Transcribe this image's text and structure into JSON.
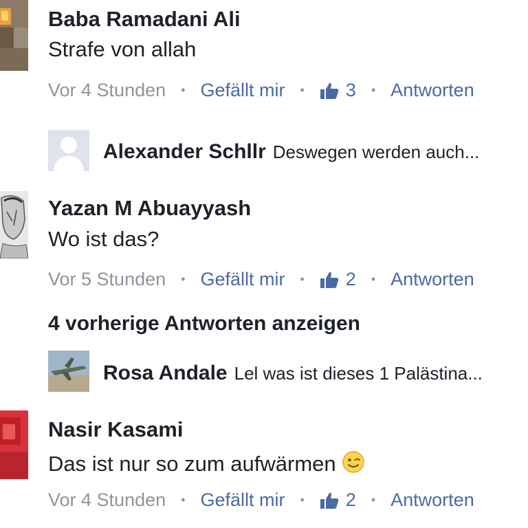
{
  "comments": [
    {
      "author": "Baba Ramadani Ali",
      "text": "Strafe von allah",
      "time": "Vor 4 Stunden",
      "like_label": "Gefällt mir",
      "like_count": "3",
      "reply_label": "Antworten",
      "reply": {
        "author": "Alexander Schllr",
        "snippet": "Deswegen werden auch..."
      }
    },
    {
      "author": "Yazan M Abuayyash",
      "text": "Wo ist das?",
      "time": "Vor 5 Stunden",
      "like_label": "Gefällt mir",
      "like_count": "2",
      "reply_label": "Antworten",
      "more_replies": "4 vorherige Antworten anzeigen",
      "reply": {
        "author": "Rosa Andale",
        "snippet": "Lel was ist dieses 1 Palästina..."
      }
    },
    {
      "author": "Nasir Kasami",
      "text": "Das ist nur so zum aufwärmen",
      "time": "Vor 4 Stunden",
      "like_label": "Gefällt mir",
      "like_count": "2",
      "reply_label": "Antworten"
    }
  ],
  "separator": "•",
  "colors": {
    "link": "#4b6aa5",
    "meta": "#90949c",
    "text": "#1d2129"
  },
  "icons": {
    "like": "thumbs-up-icon",
    "emoji": "winking-face-icon"
  }
}
